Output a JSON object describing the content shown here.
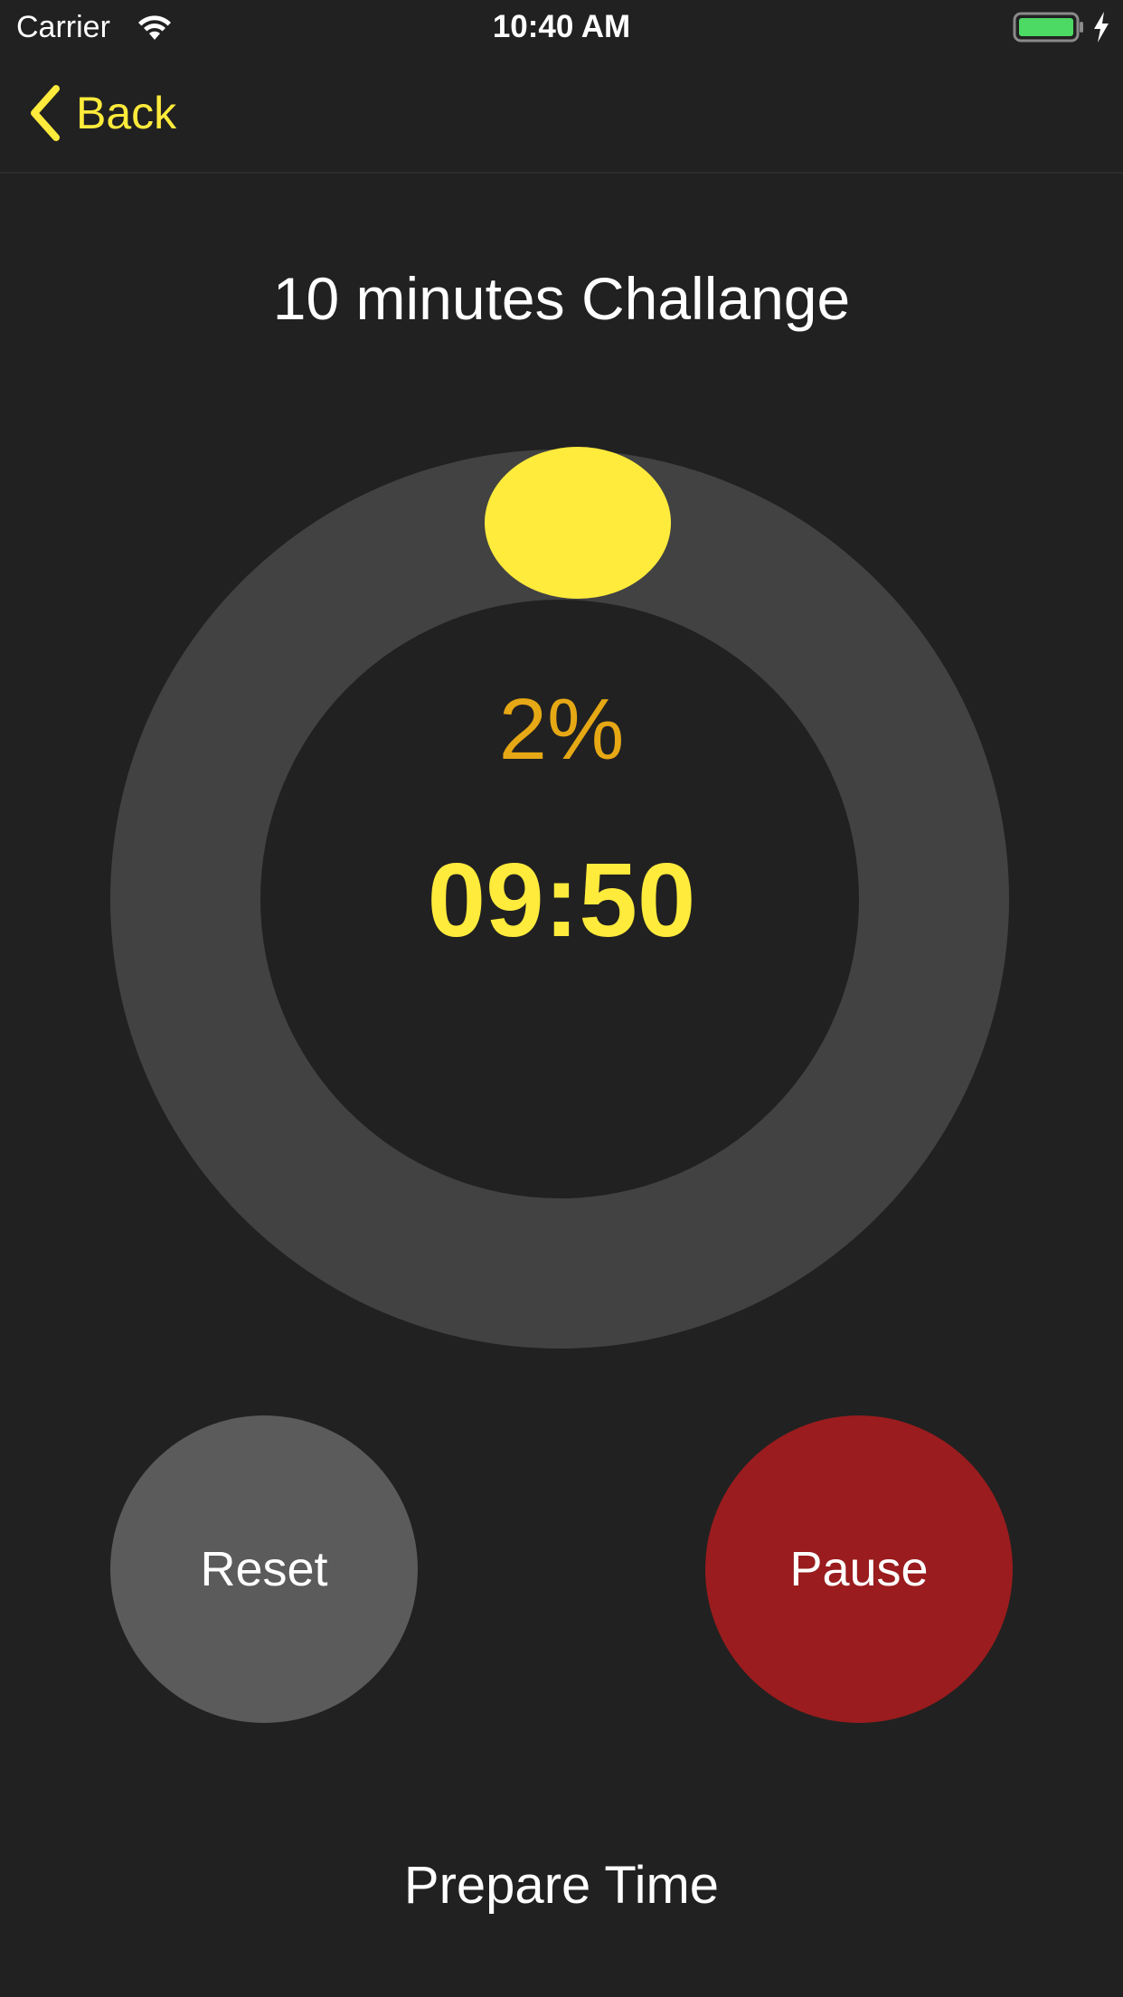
{
  "status_bar": {
    "carrier": "Carrier",
    "time": "10:40 AM",
    "wifi_icon": "wifi-icon",
    "battery_icon": "battery-charging-icon",
    "battery_color": "#4cd964"
  },
  "nav": {
    "back_label": "Back",
    "back_icon": "chevron-left-icon",
    "accent_color": "#ffeb3b"
  },
  "challenge": {
    "title": "10 minutes Challange",
    "progress_percent": "2%",
    "progress_value": 0.02,
    "timer": "09:50"
  },
  "controls": {
    "reset_label": "Reset",
    "pause_label": "Pause",
    "reset_color": "#5b5b5b",
    "pause_color": "#9a1c1e"
  },
  "footer": {
    "label": "Prepare Time"
  }
}
